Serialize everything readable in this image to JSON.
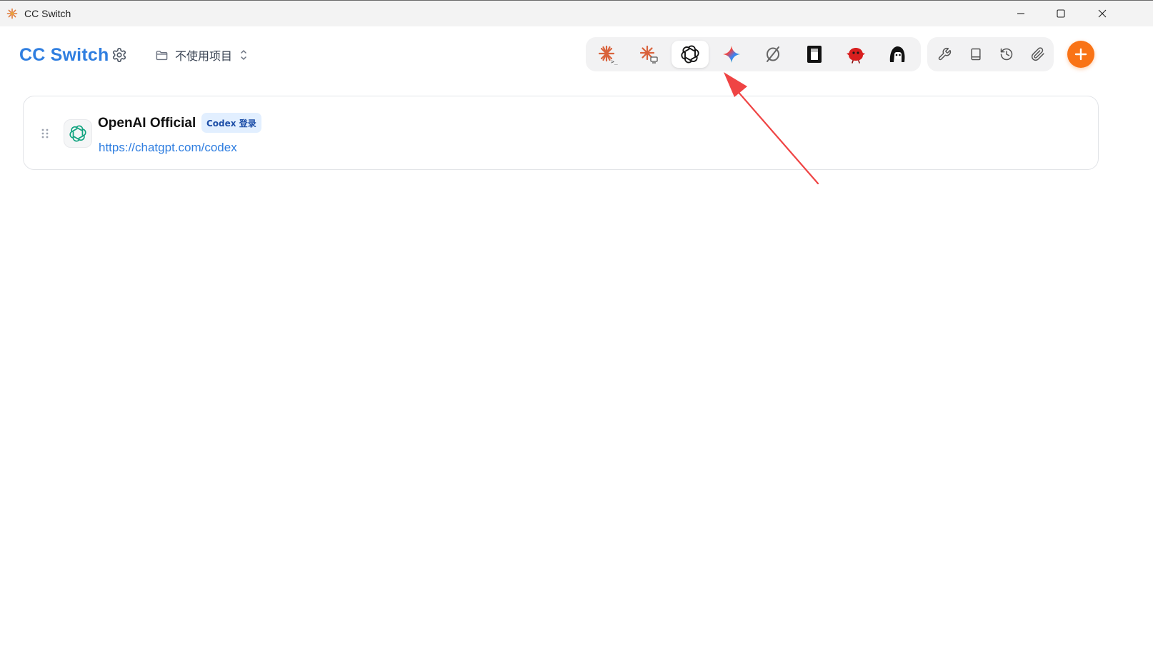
{
  "window": {
    "title": "CC Switch",
    "controls": [
      "minimize-icon",
      "maximize-icon",
      "close-icon"
    ]
  },
  "header": {
    "app_title": "CC Switch",
    "settings_icon": "gear-icon",
    "project_selector": {
      "icon": "folder-icon",
      "value": "不使用项目",
      "chevron": "chevron-up-down-icon"
    }
  },
  "app_switcher": {
    "items": [
      {
        "name": "claude-code-icon",
        "active": false
      },
      {
        "name": "claude-desktop-icon",
        "active": false
      },
      {
        "name": "openai-codex-icon",
        "active": true
      },
      {
        "name": "gemini-icon",
        "active": false
      },
      {
        "name": "opencode-icon",
        "active": false
      },
      {
        "name": "terminal-app-icon",
        "active": false
      },
      {
        "name": "red-bird-icon",
        "active": false
      },
      {
        "name": "avatar-app-icon",
        "active": false
      }
    ]
  },
  "toolbar": {
    "items": [
      "wrench-icon",
      "book-icon",
      "history-icon",
      "paperclip-icon"
    ],
    "add_button_icon": "plus-icon"
  },
  "providers": [
    {
      "name": "OpenAI Official",
      "badge": "Codex 登录",
      "url": "https://chatgpt.com/codex",
      "logo": "openai-logo-icon"
    }
  ],
  "colors": {
    "accent": "#2f7ee0",
    "add_button": "#f97316",
    "badge_bg": "#e2efff",
    "annotation_arrow": "#ef4444"
  }
}
